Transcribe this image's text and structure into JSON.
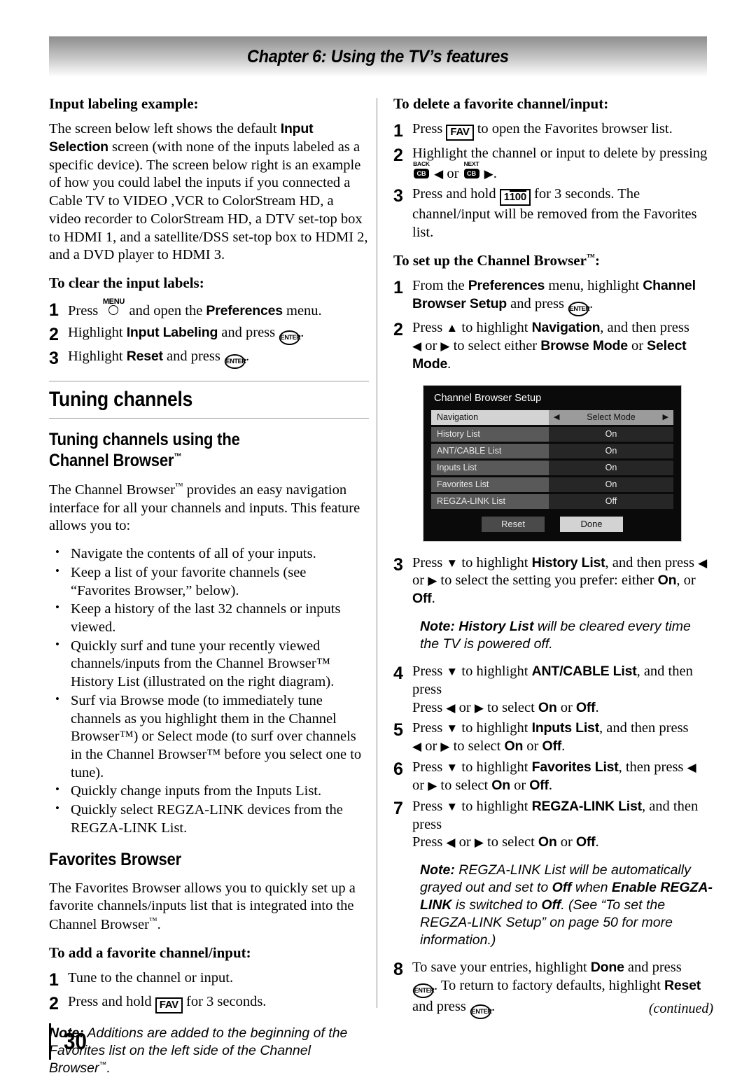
{
  "header": {
    "chapter_title": "Chapter 6: Using the TV’s features"
  },
  "left": {
    "h_input_labeling": "Input labeling example:",
    "p_intro_1": "The screen below left shows the default ",
    "p_intro_b1": "Input Selection",
    "p_intro_2": " screen (with none of the inputs labeled as a specific device). The screen below right is an example of how you could label the inputs if you connected a Cable TV to VIDEO ,VCR to ColorStream HD, a video recorder to ColorStream HD, a DTV set-top box to HDMI 1, and a satellite/DSS set-top box to HDMI 2, and a DVD player to HDMI 3.",
    "h_clear_labels": "To clear the input labels:",
    "step1_a": "Press ",
    "step1_b": " and open the ",
    "step1_bold": "Preferences",
    "step1_c": " menu.",
    "step2_a": "Highlight ",
    "step2_bold": "Input Labeling",
    "step2_b": " and press ",
    "step2_c": ".",
    "step3_a": "Highlight ",
    "step3_bold": "Reset",
    "step3_b": " and press ",
    "step3_c": ".",
    "h_tuning_channels": "Tuning channels",
    "h_tuning_using_1": "Tuning channels using the",
    "h_tuning_using_2": "Channel Browser",
    "p_cb_intro_1": "The Channel Browser",
    "p_cb_intro_2": " provides an easy navigation interface for all your channels and inputs. This feature allows you to:",
    "bullets": [
      "Navigate the contents of all of your inputs.",
      "Keep a list of your favorite channels (see “Favorites Browser,” below).",
      "Keep a history of the last 32 channels or inputs viewed.",
      "Quickly surf and tune your recently viewed channels/inputs from the Channel Browser™ History List (illustrated on the right diagram).",
      "Surf via Browse mode (to immediately tune channels as you highlight them in the Channel Browser™) or Select mode (to surf over channels in the Channel Browser™ before you select one to tune).",
      "Quickly change inputs from the Inputs List.",
      "Quickly select REGZA-LINK devices from the REGZA-LINK List."
    ],
    "h_favorites_browser": "Favorites Browser",
    "p_fav_1": "The Favorites Browser allows you to quickly set up a favorite channels/inputs list that is integrated into the Channel Browser",
    "p_fav_2": ".",
    "h_add_favorite": "To add a favorite channel/input:",
    "add_step1": "Tune to the channel or input.",
    "add_step2_a": "Press and hold ",
    "add_step2_b": " for 3 seconds.",
    "note_additions_label": "Note:",
    "note_additions_1": " Additions are added to the beginning of the Favorites list on the left side of the Channel Browser",
    "note_additions_2": "."
  },
  "right": {
    "h_delete_favorite": "To delete a favorite channel/input:",
    "del_step1_a": "Press ",
    "del_step1_b": " to open the Favorites browser list.",
    "del_step2_a": "Highlight the channel or input to delete by pressing ",
    "del_step2_or": " or ",
    "del_step2_end": ".",
    "del_step3_a": "Press and hold ",
    "del_step3_b": " for 3 seconds. The channel/input will be removed from the Favorites list.",
    "h_setup_cb_1": "To set up the Channel Browser",
    "h_setup_cb_2": ":",
    "setup_step1_a": "From the ",
    "setup_step1_b1": "Preferences",
    "setup_step1_b": " menu, highlight ",
    "setup_step1_b2": "Channel Browser Setup",
    "setup_step1_c": " and press ",
    "setup_step1_d": ".",
    "setup_step2_a": "Press ",
    "setup_step2_b": " to highlight ",
    "setup_step2_b1": "Navigation",
    "setup_step2_c": ", and then press ",
    "setup_step2_or": " or ",
    "setup_step2_d": " to select either ",
    "setup_step2_b2": "Browse Mode",
    "setup_step2_e": " or ",
    "setup_step2_b3": "Select Mode",
    "setup_step2_f": ".",
    "step3_a": "Press ",
    "step3_b": " to highlight ",
    "step3_b1": "History List",
    "step3_c": ", and then press ",
    "step3_or": " or ",
    "step3_d": " to select the setting you prefer: either ",
    "step3_on": "On",
    "step3_e": ", or ",
    "step3_off": "Off",
    "step3_f": ".",
    "note_history_label": "Note: History List",
    "note_history_text": " will be cleared every time the TV is powered off.",
    "step4_a": "Press ",
    "step4_b": " to highlight ",
    "step4_b1": "ANT/CABLE List",
    "step4_c": ", and then press ",
    "step4_or": " or ",
    "step4_d": " to select ",
    "step4_on": "On",
    "step4_e": " or ",
    "step4_off": "Off",
    "step4_f": ".",
    "step5_b1": "Inputs List",
    "step5_c": ", and then press ",
    "step6_b1": "Favorites List",
    "step6_c": ", then press ",
    "step7_b1": "REGZA-LINK List",
    "note_regza_label": "Note:",
    "note_regza_1": " REGZA-LINK List will be automatically grayed out and set to ",
    "note_regza_off1": "Off",
    "note_regza_2": " when ",
    "note_regza_b1": "Enable REGZA-LINK",
    "note_regza_3": " is switched to ",
    "note_regza_off2": "Off",
    "note_regza_4": ". (See “To set the REGZA-LINK Setup” on page 50 for more information.)",
    "step8_a": "To save your entries, highlight ",
    "step8_b1": "Done",
    "step8_b": " and press ",
    "step8_c": ". To return to factory defaults, highlight ",
    "step8_b2": "Reset",
    "step8_d": " and press ",
    "step8_e": "."
  },
  "osd": {
    "title": "Channel Browser Setup",
    "rows": [
      {
        "label": "Navigation",
        "value": "Select Mode",
        "highlighted": true,
        "arrows": true
      },
      {
        "label": "History List",
        "value": "On",
        "highlighted": false,
        "arrows": false
      },
      {
        "label": "ANT/CABLE List",
        "value": "On",
        "highlighted": false,
        "arrows": false
      },
      {
        "label": "Inputs List",
        "value": "On",
        "highlighted": false,
        "arrows": false
      },
      {
        "label": "Favorites List",
        "value": "On",
        "highlighted": false,
        "arrows": false
      },
      {
        "label": "REGZA-LINK List",
        "value": "Off",
        "highlighted": false,
        "arrows": false
      }
    ],
    "reset_button": "Reset",
    "done_button": "Done",
    "arrow_left": "◀",
    "arrow_right": "▶"
  },
  "keys": {
    "enter": "ENTER",
    "fav": "FAV",
    "hundred": "100",
    "menu": "MENU",
    "cb": "CB",
    "back": "BACK",
    "next": "NEXT"
  },
  "glyphs": {
    "left": "◀",
    "right": "▶",
    "up": "▲",
    "down": "▼",
    "tm": "™"
  },
  "footer": {
    "page_number": "30",
    "continued": "(continued)"
  }
}
